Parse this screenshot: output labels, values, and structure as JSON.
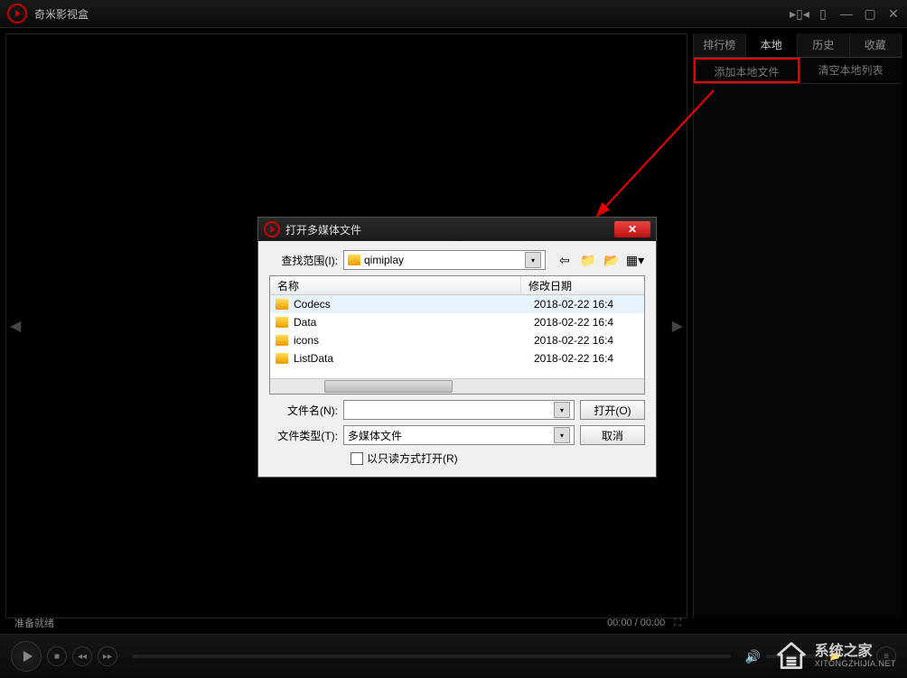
{
  "app": {
    "title": "奇米影视盒"
  },
  "sidebar": {
    "tabs": [
      "排行榜",
      "本地",
      "历史",
      "收藏"
    ],
    "active_tab_index": 1,
    "actions": {
      "add_local": "添加本地文件",
      "clear_local": "清空本地列表"
    }
  },
  "status": {
    "text": "准备就绪",
    "time": "00:00 / 00:00"
  },
  "dialog": {
    "title": "打开多媒体文件",
    "look_in_label": "查找范围(I):",
    "current_folder": "qimiplay",
    "columns": {
      "name": "名称",
      "modified": "修改日期"
    },
    "rows": [
      {
        "name": "Codecs",
        "date": "2018-02-22 16:4"
      },
      {
        "name": "Data",
        "date": "2018-02-22 16:4"
      },
      {
        "name": "icons",
        "date": "2018-02-22 16:4"
      },
      {
        "name": "ListData",
        "date": "2018-02-22 16:4"
      }
    ],
    "filename_label": "文件名(N):",
    "filetype_label": "文件类型(T):",
    "filetype_value": "多媒体文件",
    "open_btn": "打开(O)",
    "cancel_btn": "取消",
    "readonly_label": "以只读方式打开(R)"
  },
  "watermark": {
    "cn": "系统之家",
    "en": "XITONGZHIJIA.NET"
  }
}
